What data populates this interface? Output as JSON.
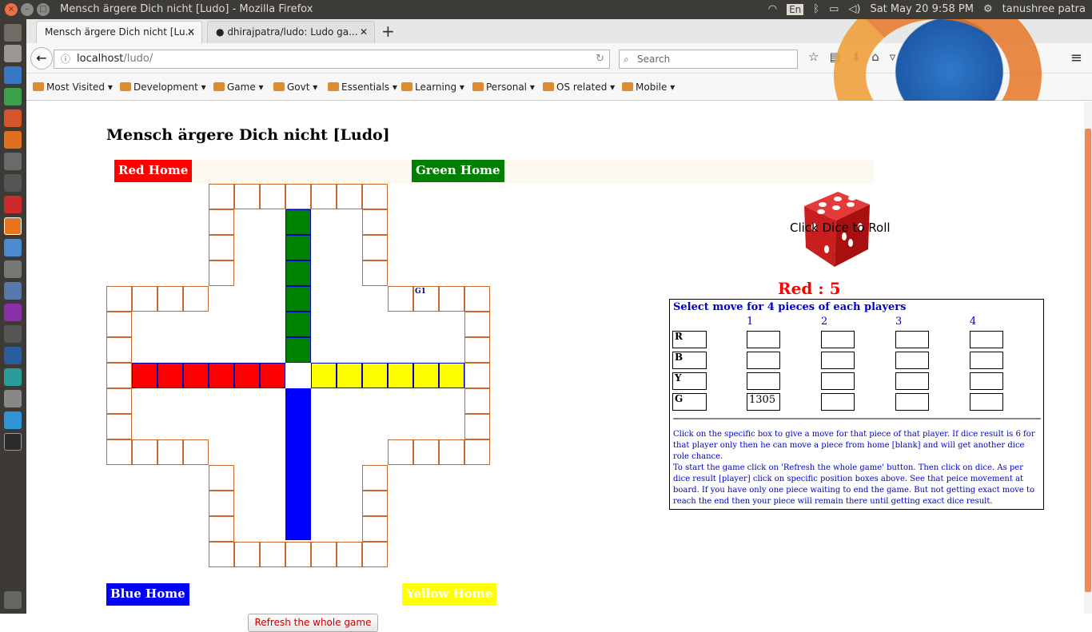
{
  "system": {
    "window_title": "Mensch ärgere Dich nicht [Ludo] - Mozilla Firefox",
    "lang": "En",
    "datetime": "Sat May 20  9:58 PM",
    "user": "tanushree patra"
  },
  "browser": {
    "tabs": [
      {
        "label": "Mensch ärgere Dich nicht [Lu..."
      },
      {
        "label": "dhirajpatra/ludo: Ludo ga..."
      }
    ],
    "url_host": "localhost",
    "url_path": "/ludo/",
    "search_placeholder": "Search",
    "bookmarks": [
      "Most Visited",
      "Development",
      "Game",
      "Govt",
      "Essentials",
      "Learning",
      "Personal",
      "OS related",
      "Mobile"
    ]
  },
  "page": {
    "title": "Mensch ärgere Dich nicht [Ludo]",
    "homes": {
      "red": "Red Home",
      "green": "Green Home",
      "blue": "Blue Home",
      "yellow": "Yellow Home"
    },
    "pieces_on_board": [
      "G1"
    ],
    "refresh_label": "Refresh the whole game",
    "dice_label": "Click Dice to Roll",
    "result": "Red : 5",
    "colors": {
      "red": "#ff0000",
      "green": "#008000",
      "yellow": "#ffff00",
      "blue": "#0000ff",
      "path_border": "#c66a2e"
    },
    "panel": {
      "heading": "Select move for 4 pieces of each players",
      "columns": [
        "1",
        "2",
        "3",
        "4"
      ],
      "rows": [
        {
          "label": "R",
          "values": [
            "",
            "",
            "",
            ""
          ]
        },
        {
          "label": "B",
          "values": [
            "",
            "",
            "",
            ""
          ]
        },
        {
          "label": "Y",
          "values": [
            "",
            "",
            "",
            ""
          ]
        },
        {
          "label": "G",
          "values": [
            "1305",
            "",
            "",
            ""
          ]
        }
      ],
      "instructions": [
        "Click on the specific box to give a move for that piece of that player. If dice result is 6 for that player only then he can move a piece from home [blank] and will get another dice role chance.",
        "To start the game click on 'Refresh the whole game' button. Then click on dice. As per dice result [player] click on specific position boxes above. See that peice movement at board. If you have only one piece waiting to end the game. But not getting exact move to reach the end then your piece will remain there until getting exact dice result."
      ]
    }
  }
}
